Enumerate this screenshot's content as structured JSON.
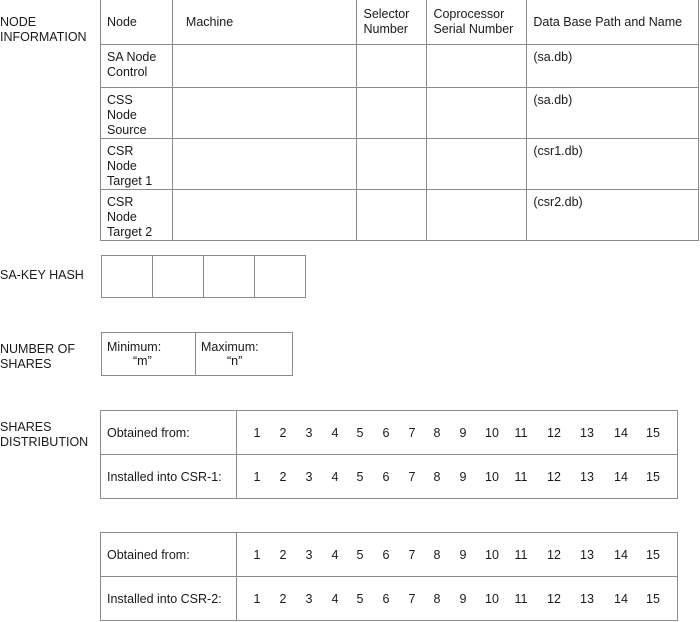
{
  "sections": {
    "node_information": "NODE\nINFORMATION",
    "sa_key_hash": "SA-KEY HASH",
    "number_of_shares": "NUMBER OF\nSHARES",
    "shares_distribution": "SHARES\nDISTRIBUTION"
  },
  "node_table": {
    "headers": [
      "Node",
      "Machine",
      "Selector\nNumber",
      "Coprocessor\nSerial Number",
      "Data Base Path and Name"
    ],
    "rows": [
      {
        "node": "SA Node\nControl",
        "machine": "",
        "selector": "",
        "serial": "",
        "db": "(sa.db)"
      },
      {
        "node": "CSS Node\nSource",
        "machine": "",
        "selector": "",
        "serial": "",
        "db": "(sa.db)"
      },
      {
        "node": "CSR Node\nTarget 1",
        "machine": "",
        "selector": "",
        "serial": "",
        "db": "(csr1.db)"
      },
      {
        "node": "CSR Node\nTarget 2",
        "machine": "",
        "selector": "",
        "serial": "",
        "db": "(csr2.db)"
      }
    ]
  },
  "sa_key_hash": {
    "cells": [
      "",
      "",
      "",
      ""
    ]
  },
  "number_of_shares": {
    "minimum_label": "Minimum:",
    "minimum_value": "“m”",
    "maximum_label": "Maximum:",
    "maximum_value": "“n”"
  },
  "distribution_tables": [
    {
      "rows": [
        {
          "label": "Obtained from:",
          "numbers": [
            "1",
            "2",
            "3",
            "4",
            "5",
            "6",
            "7",
            "8",
            "9",
            "10",
            "11",
            "12",
            "13",
            "14",
            "15"
          ]
        },
        {
          "label": "Installed into CSR-1:",
          "numbers": [
            "1",
            "2",
            "3",
            "4",
            "5",
            "6",
            "7",
            "8",
            "9",
            "10",
            "11",
            "12",
            "13",
            "14",
            "15"
          ]
        }
      ]
    },
    {
      "rows": [
        {
          "label": "Obtained from:",
          "numbers": [
            "1",
            "2",
            "3",
            "4",
            "5",
            "6",
            "7",
            "8",
            "9",
            "10",
            "11",
            "12",
            "13",
            "14",
            "15"
          ]
        },
        {
          "label": "Installed into CSR-2:",
          "numbers": [
            "1",
            "2",
            "3",
            "4",
            "5",
            "6",
            "7",
            "8",
            "9",
            "10",
            "11",
            "12",
            "13",
            "14",
            "15"
          ]
        }
      ]
    }
  ]
}
